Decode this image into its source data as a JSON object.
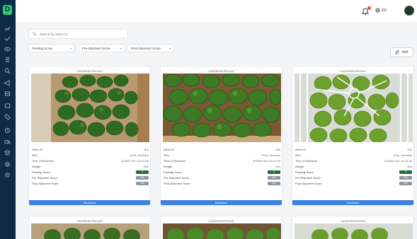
{
  "sidebar": {
    "logo": "D",
    "items": [
      "chart-icon",
      "check-icon",
      "eye-icon",
      "list-icon",
      "search-icon",
      "megaphone-icon",
      "box-icon",
      "folder-icon",
      "tag-icon",
      "clock-icon",
      "truck-icon",
      "layers-icon",
      "gear-icon",
      "settings-icon"
    ]
  },
  "header": {
    "lang": "EN"
  },
  "search": {
    "placeholder": "Search by carton ID"
  },
  "filters": {
    "packing": "Packing Score",
    "pre_shipment": "Pre-shipment Score",
    "post_shipment": "Post-shipment Score"
  },
  "sort_label": "Sort",
  "cards": [
    {
      "carton_id": "CA2000057RIOAH",
      "fields": {
        "other_id": {
          "label": "Other ID",
          "value": "N/A"
        },
        "sku": {
          "label": "SKU",
          "value": "Peru_Avocado"
        },
        "time": {
          "label": "Time of Received",
          "value": "2025/07/20 | 20:14:39"
        },
        "weight": {
          "label": "Weight",
          "value": "N/A"
        },
        "packing": {
          "label": "Packing Score",
          "value": "9"
        },
        "pre": {
          "label": "Pre-Shipment Score",
          "value": "N/A"
        },
        "post": {
          "label": "Post-Shipment Score",
          "value": "N/A"
        }
      },
      "status": "Received"
    },
    {
      "carton_id": "CA2000057RIOAG",
      "fields": {
        "other_id": {
          "label": "Other ID",
          "value": "N/A"
        },
        "sku": {
          "label": "SKU",
          "value": "Peru_Avocado"
        },
        "time": {
          "label": "Time of Received",
          "value": "2025/07/20 | 20:14:39"
        },
        "weight": {
          "label": "Weight",
          "value": "N/A"
        },
        "packing": {
          "label": "Packing Score",
          "value": "9"
        },
        "pre": {
          "label": "Pre-Shipment Score",
          "value": "N/A"
        },
        "post": {
          "label": "Post-Shipment Score",
          "value": "N/A"
        }
      },
      "status": "Received"
    },
    {
      "carton_id": "CA2000057RIOAX",
      "fields": {
        "other_id": {
          "label": "Other ID",
          "value": "N/A"
        },
        "sku": {
          "label": "SKU",
          "value": "Peru_Avocado"
        },
        "time": {
          "label": "Time of Received",
          "value": "2025/07/20 | 20:14:39"
        },
        "weight": {
          "label": "Weight",
          "value": "N/A"
        },
        "packing": {
          "label": "Packing Score",
          "value": "9"
        },
        "pre": {
          "label": "Pre-Shipment Score",
          "value": "N/A"
        },
        "post": {
          "label": "Post-Shipment Score",
          "value": "N/A"
        }
      },
      "status": "Received"
    },
    {
      "carton_id": "CA2000057RIOAR"
    },
    {
      "carton_id": "CA2000057RIOAS"
    },
    {
      "carton_id": "CA2000057RIOAT"
    }
  ],
  "colors": {
    "sidebar": "#0d2b45",
    "accent_green": "#1f6e3a",
    "status_blue": "#3b82e0"
  }
}
